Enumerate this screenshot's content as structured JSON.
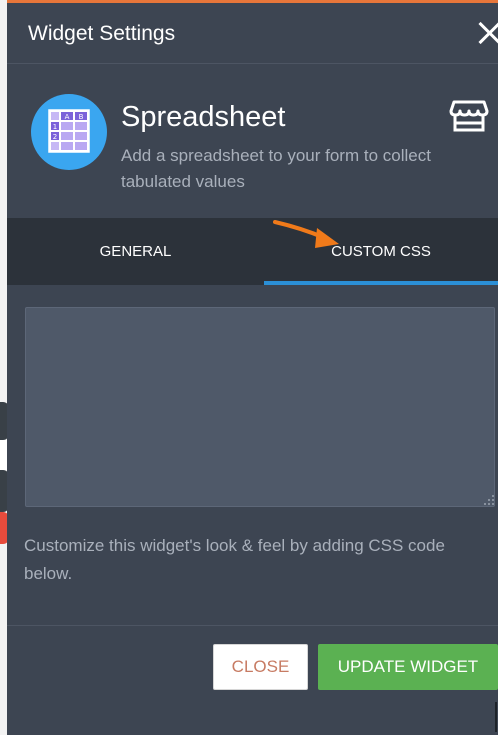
{
  "header": {
    "title": "Widget Settings"
  },
  "widget": {
    "name": "Spreadsheet",
    "description": "Add a spreadsheet to your form to collect tabulated values",
    "icon": "spreadsheet-grid-icon",
    "store_icon": "store-icon"
  },
  "tabs": [
    {
      "label": "GENERAL",
      "active": false
    },
    {
      "label": "CUSTOM CSS",
      "active": true
    }
  ],
  "css_editor": {
    "value": ""
  },
  "help_text": "Customize this widget's look & feel by adding CSS code below.",
  "buttons": {
    "close": "CLOSE",
    "update": "UPDATE WIDGET"
  },
  "colors": {
    "panel": "#3d4552",
    "tab_bar": "#2c323a",
    "active_tab": "#2b8fd6",
    "primary_button": "#5bb152",
    "logo": "#3aa6f0",
    "annotation_arrow": "#f07a1a"
  }
}
